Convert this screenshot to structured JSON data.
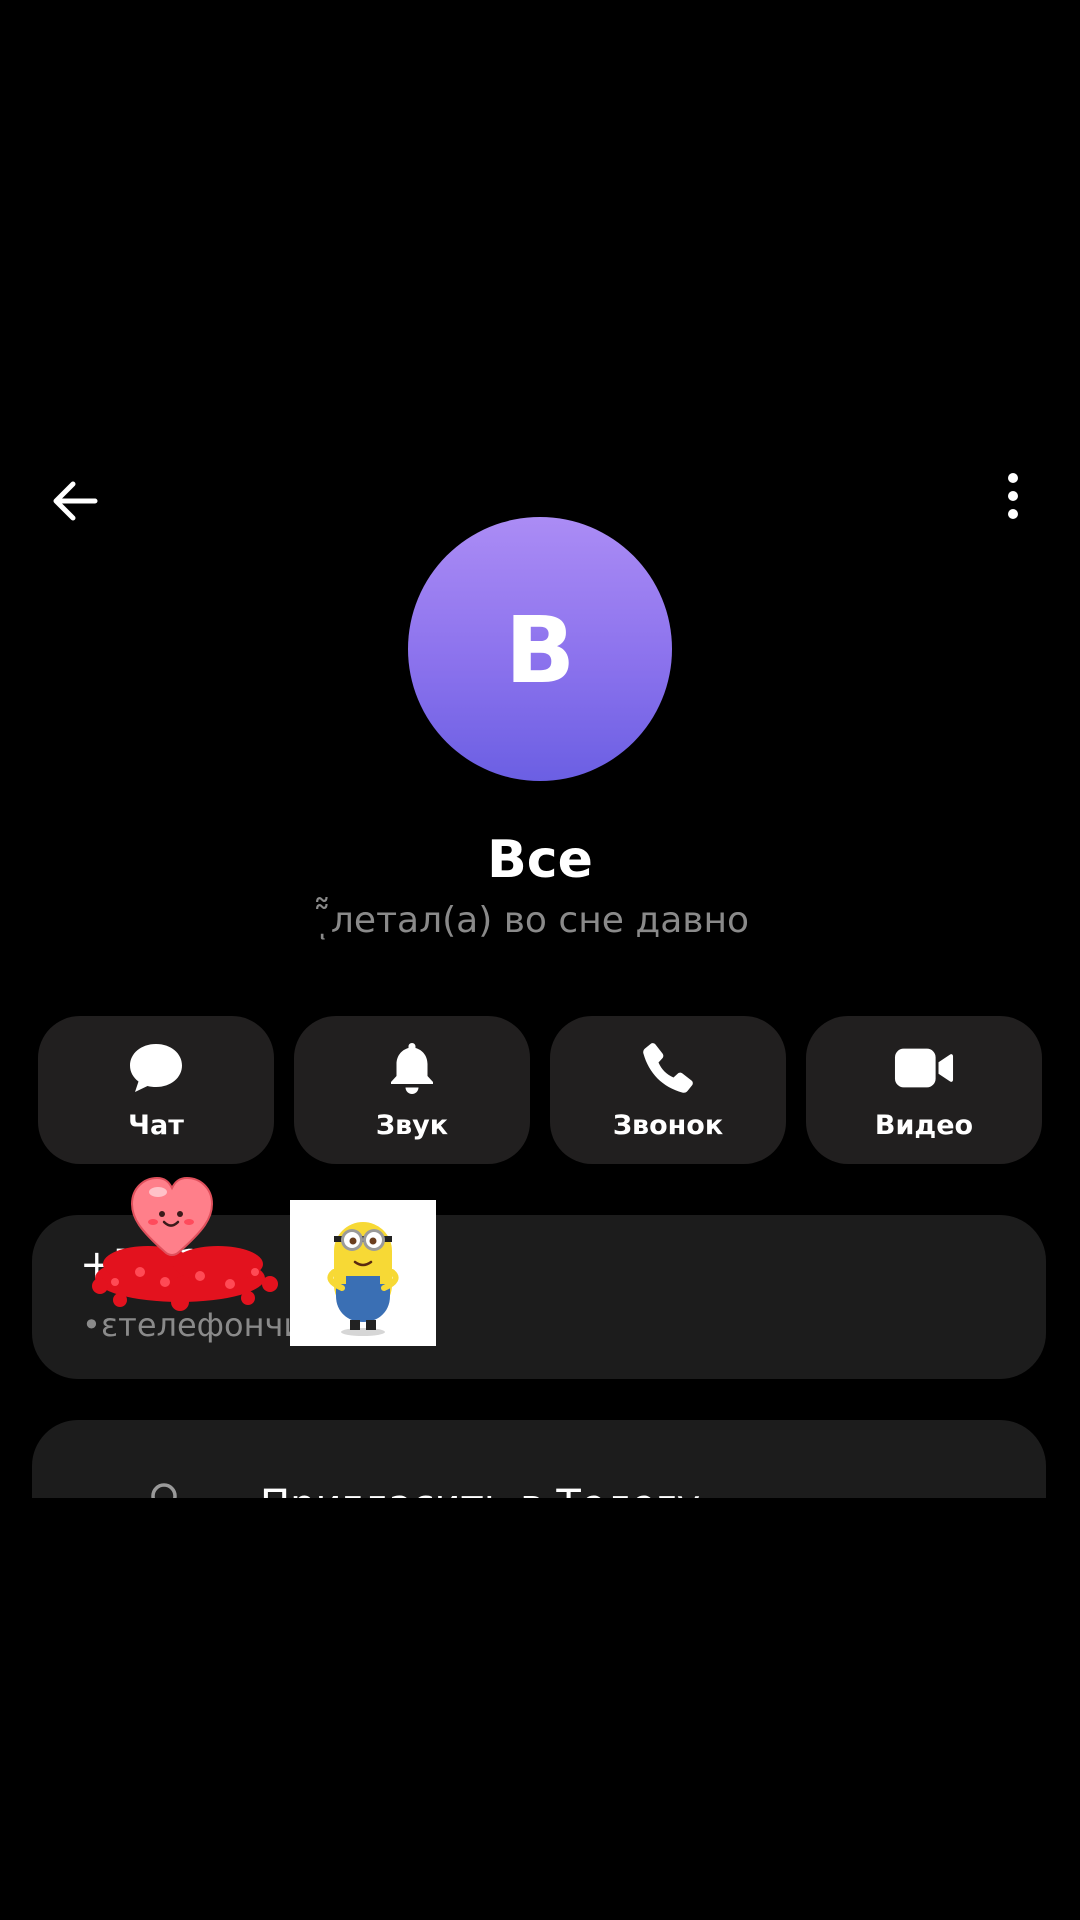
{
  "header": {
    "back_icon": "arrow-left-icon",
    "more_icon": "more-vertical-icon"
  },
  "profile": {
    "avatar_letter": "В",
    "avatar_gradient": [
      "#ab8cf5",
      "#6b5fe3"
    ],
    "name": "Все",
    "status": "͂͂ͅлетал(а) во сне давно"
  },
  "actions": [
    {
      "label": "Чат",
      "icon": "chat-bubble-icon"
    },
    {
      "label": "Звук",
      "icon": "bell-icon"
    },
    {
      "label": "Звонок",
      "icon": "phone-icon"
    },
    {
      "label": "Видео",
      "icon": "video-camera-icon"
    }
  ],
  "contact": {
    "phone": "+7         61     0",
    "phone_label": "•ɛтелефончи"
  },
  "invite": {
    "label": "Пригласить в Телегу",
    "icon": "add-user-icon"
  },
  "colors": {
    "background": "#000000",
    "card": "#1c1c1c",
    "button": "#211f1f",
    "secondary_text": "#8a8a8a"
  }
}
